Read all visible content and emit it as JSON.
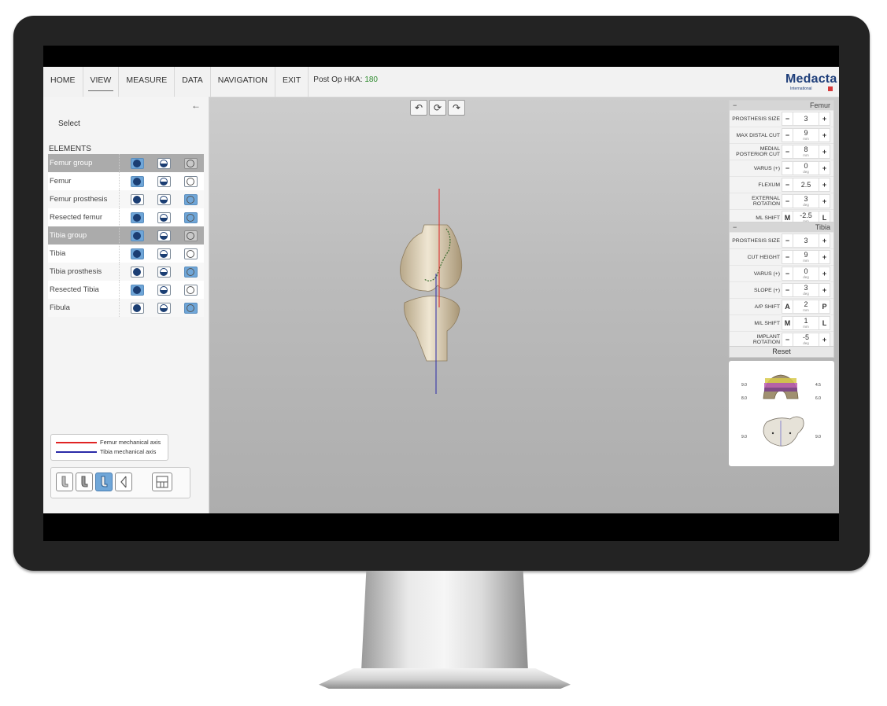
{
  "menu": {
    "items": [
      "HOME",
      "VIEW",
      "MEASURE",
      "DATA",
      "NAVIGATION",
      "EXIT"
    ],
    "active": "VIEW",
    "hka_label": "Post Op HKA:",
    "hka_value": "180"
  },
  "logo": {
    "word": "Medacta",
    "sub": "International"
  },
  "left_panel": {
    "back_icon": "arrow-left-icon",
    "select_label": "Select",
    "elements_title": "ELEMENTS",
    "rows": [
      {
        "name": "Femur group",
        "group": true,
        "solid": "on",
        "half": "off",
        "hide": "grey"
      },
      {
        "name": "Femur",
        "group": false,
        "solid": "on",
        "half": "off",
        "hide": "off"
      },
      {
        "name": "Femur prosthesis",
        "group": false,
        "solid": "off",
        "half": "off",
        "hide": "on"
      },
      {
        "name": "Resected femur",
        "group": false,
        "solid": "on",
        "half": "off",
        "hide": "on"
      },
      {
        "name": "Tibia group",
        "group": true,
        "solid": "on",
        "half": "off",
        "hide": "grey"
      },
      {
        "name": "Tibia",
        "group": false,
        "solid": "on",
        "half": "off",
        "hide": "off"
      },
      {
        "name": "Tibia prosthesis",
        "group": false,
        "solid": "off",
        "half": "off",
        "hide": "on"
      },
      {
        "name": "Resected Tibia",
        "group": false,
        "solid": "on",
        "half": "off",
        "hide": "off"
      },
      {
        "name": "Fibula",
        "group": false,
        "solid": "off",
        "half": "off",
        "hide": "on"
      }
    ],
    "legend": [
      {
        "label": "Femur mechanical axis",
        "color": "#e02424"
      },
      {
        "label": "Tibia mechanical axis",
        "color": "#2a2aa8"
      }
    ],
    "view_tools": [
      "femur-view-icon",
      "tibia-view-icon",
      "knee-view-icon",
      "axis-view-icon",
      "layout-icon"
    ],
    "active_tool": "knee-view-icon"
  },
  "viewport": {
    "camera_buttons": [
      "rotate-left-icon",
      "reset-view-icon",
      "rotate-right-icon"
    ]
  },
  "femur_panel": {
    "collapse": "−",
    "title": "Femur",
    "rows": [
      {
        "label": "PROSTHESIS SIZE",
        "left": "−",
        "value": "3",
        "unit": "",
        "right": "+"
      },
      {
        "label": "MAX DISTAL CUT",
        "left": "−",
        "value": "9",
        "unit": "mm",
        "right": "+"
      },
      {
        "label": "MEDIAL POSTERIOR CUT",
        "left": "−",
        "value": "8",
        "unit": "mm",
        "right": "+"
      },
      {
        "label": "VARUS (+)",
        "left": "−",
        "value": "0",
        "unit": "deg",
        "right": "+"
      },
      {
        "label": "FLEXUM",
        "left": "−",
        "value": "2.5",
        "unit": "",
        "right": "+"
      },
      {
        "label": "EXTERNAL ROTATION",
        "left": "−",
        "value": "3",
        "unit": "deg",
        "right": "+"
      },
      {
        "label": "ML SHIFT",
        "left": "M",
        "value": "-2.5",
        "unit": "mm",
        "right": "L"
      }
    ]
  },
  "tibia_panel": {
    "collapse": "−",
    "title": "Tibia",
    "rows": [
      {
        "label": "PROSTHESIS SIZE",
        "left": "−",
        "value": "3",
        "unit": "",
        "right": "+"
      },
      {
        "label": "CUT HEIGHT",
        "left": "−",
        "value": "9",
        "unit": "mm",
        "right": "+"
      },
      {
        "label": "VARUS (+)",
        "left": "−",
        "value": "0",
        "unit": "deg",
        "right": "+"
      },
      {
        "label": "SLOPE (+)",
        "left": "−",
        "value": "3",
        "unit": "deg",
        "right": "+"
      },
      {
        "label": "A/P SHIFT",
        "left": "A",
        "value": "2",
        "unit": "mm",
        "right": "P"
      },
      {
        "label": "M/L SHIFT",
        "left": "M",
        "value": "1",
        "unit": "mm",
        "right": "L"
      },
      {
        "label": "IMPLANT ROTATION",
        "left": "−",
        "value": "-5",
        "unit": "deg",
        "right": "+"
      }
    ]
  },
  "reset_label": "Reset",
  "preview": {
    "femur_left_top": "9.0",
    "femur_left_bottom": "8.0",
    "femur_right_top": "4.5",
    "femur_right_bottom": "6.0",
    "tibia_left": "9.0",
    "tibia_right": "9.0"
  }
}
